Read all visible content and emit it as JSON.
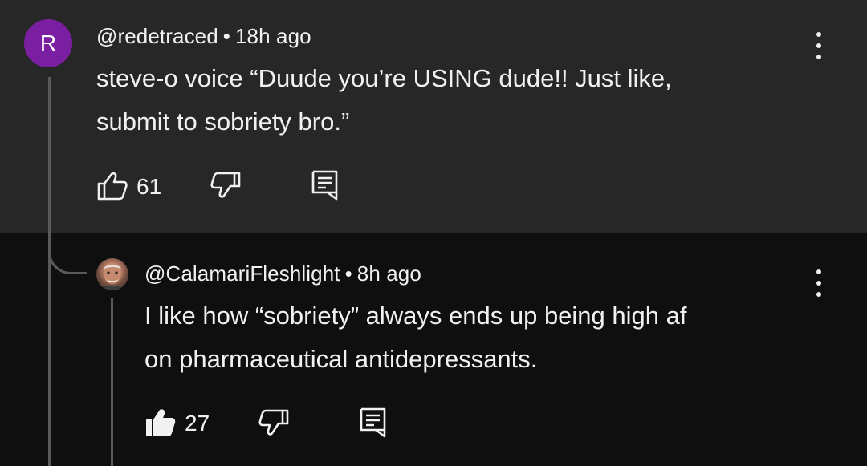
{
  "top_comment": {
    "avatar_letter": "R",
    "handle": "@redetraced",
    "separator": "•",
    "time": "18h ago",
    "text_line1": "steve-o voice “Duude you’re USING dude!! Just like,",
    "text_line2": "submit to sobriety bro.”",
    "like_count": "61"
  },
  "reply": {
    "handle": "@CalamariFleshlight",
    "separator": "•",
    "time": "8h ago",
    "text_line1": "I like how “sobriety” always ends up being high af",
    "text_line2": "on pharmaceutical antidepressants.",
    "like_count": "27"
  },
  "colors": {
    "highlight_bg": "#272727",
    "page_bg": "#0f0f0f",
    "avatar_bg": "#7b1fa2",
    "text": "#f1f1f1"
  }
}
